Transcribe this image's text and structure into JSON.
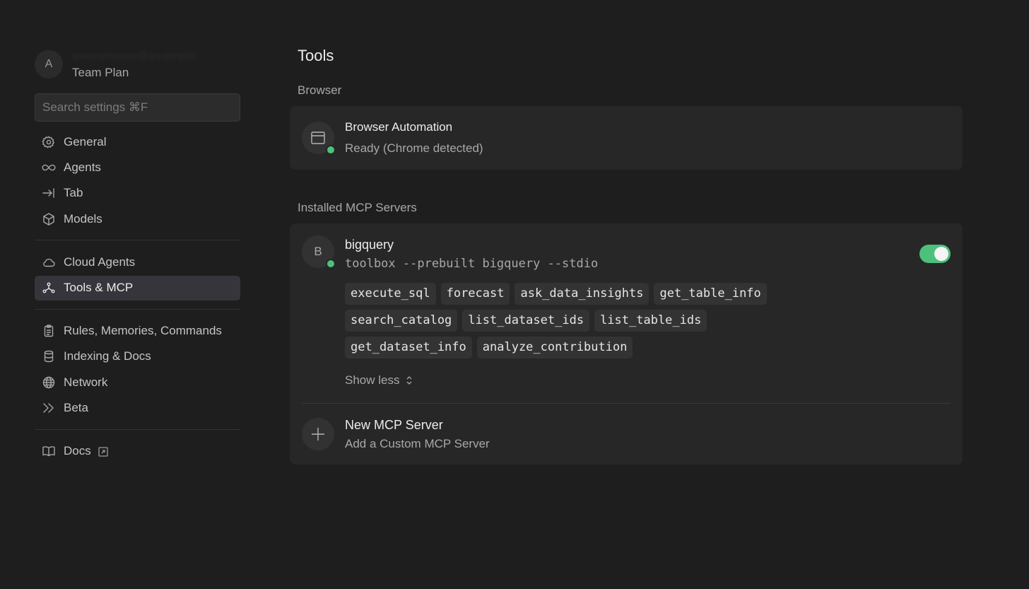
{
  "account": {
    "avatar_letter": "A",
    "name": "anonymous@example",
    "plan": "Team Plan"
  },
  "search": {
    "placeholder": "Search settings ⌘F"
  },
  "sidebar": {
    "group1": [
      {
        "label": "General",
        "icon": "gear-icon"
      },
      {
        "label": "Agents",
        "icon": "infinity-icon"
      },
      {
        "label": "Tab",
        "icon": "arrow-right-bar-icon"
      },
      {
        "label": "Models",
        "icon": "cube-icon"
      }
    ],
    "group2": [
      {
        "label": "Cloud Agents",
        "icon": "cloud-icon"
      },
      {
        "label": "Tools & MCP",
        "icon": "nodes-icon",
        "active": true
      }
    ],
    "group3": [
      {
        "label": "Rules, Memories, Commands",
        "icon": "clipboard-icon"
      },
      {
        "label": "Indexing & Docs",
        "icon": "database-icon"
      },
      {
        "label": "Network",
        "icon": "globe-icon"
      },
      {
        "label": "Beta",
        "icon": "double-chevron-icon"
      }
    ],
    "group4": [
      {
        "label": "Docs",
        "icon": "book-icon",
        "external": true
      }
    ]
  },
  "main": {
    "title": "Tools",
    "browser_section": "Browser",
    "browser": {
      "title": "Browser Automation",
      "status": "Ready (Chrome detected)",
      "status_color": "#4cc17a"
    },
    "mcp_section": "Installed MCP Servers",
    "server": {
      "letter": "B",
      "name": "bigquery",
      "command": "toolbox --prebuilt bigquery --stdio",
      "enabled": true,
      "tools": [
        "execute_sql",
        "forecast",
        "ask_data_insights",
        "get_table_info",
        "search_catalog",
        "list_dataset_ids",
        "list_table_ids",
        "get_dataset_info",
        "analyze_contribution"
      ],
      "show_less": "Show less"
    },
    "new_server": {
      "title": "New MCP Server",
      "subtitle": "Add a Custom MCP Server"
    }
  },
  "colors": {
    "accent_green": "#4cc17a",
    "active_bg": "#35353b",
    "background": "#1e1e1e"
  }
}
